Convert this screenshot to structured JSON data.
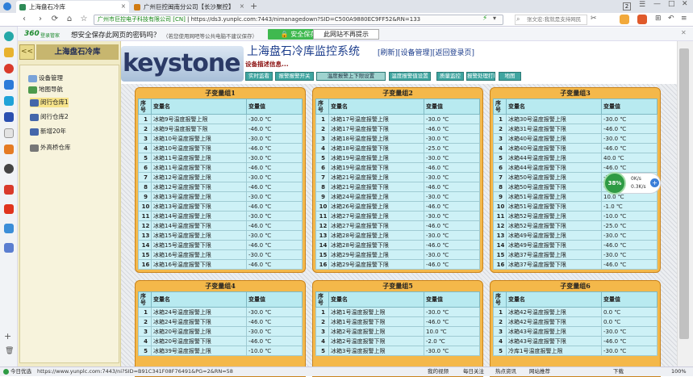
{
  "browser": {
    "tabs": [
      {
        "label": "上海盘石冷库",
        "color": "#2e8b57"
      },
      {
        "label": "广州巨控闽南分公司【长沙聚控】",
        "color": "#d07a10"
      }
    ],
    "tab_count": "2",
    "url_cert": "广州市巨控电子科技有限公司 [CN]",
    "url": "https://ds3.yunplc.com:7443/nimanagedown?SID=C500A9880EC9FF52&RN=133",
    "search_placeholder": "张文宏:我就是支持网民"
  },
  "password_bar": {
    "brand": "360",
    "brand_sub": "登录管家",
    "question": "想安全保存此网页的密码吗？",
    "hint": "（若您使用网吧等公共电脑不建议保存）",
    "save_label": "安全保存",
    "never_label": "此网站不再提示"
  },
  "left_panel": {
    "collapse_label": "<<",
    "system_name": "上海盘石冷库",
    "tree": [
      {
        "label": "设备管理",
        "icon": "gear-icon",
        "indent": 1,
        "color": "#7aa3d8",
        "selected": false
      },
      {
        "label": "地图导航",
        "icon": "globe-icon",
        "indent": 1,
        "color": "#4c9a4c",
        "selected": false
      },
      {
        "label": "闵行仓库1",
        "icon": "monitor-icon",
        "indent": 2,
        "color": "#4466aa",
        "selected": true
      },
      {
        "label": "闵行仓库2",
        "icon": "monitor-icon",
        "indent": 2,
        "color": "#4466aa",
        "selected": false
      },
      {
        "label": "新增20年",
        "icon": "monitor-icon",
        "indent": 2,
        "color": "#4466aa",
        "selected": false
      },
      {
        "label": "外高桥仓库",
        "icon": "monitor-icon",
        "indent": 2,
        "color": "#777777",
        "selected": false
      }
    ]
  },
  "header": {
    "logo_text": "keystone",
    "title": "上海盘石冷库监控系统",
    "links": "[刷新][设备管理][返回登录页]",
    "description": "设备描述信息...",
    "nav": [
      "实时监看",
      "报警报警开关",
      "温度报警上下限设置",
      "温度报警值设置",
      "质量监控",
      "报警处理打印",
      "地图"
    ],
    "nav_active": 2
  },
  "groups": [
    {
      "title": "子变量组1",
      "col_idx": "序号",
      "col_name": "变量名",
      "col_val": "变量值",
      "rows": [
        [
          "1",
          "冰箱9号温度报警上限",
          "-30.0 ℃"
        ],
        [
          "2",
          "冰箱9号温度报警下限",
          "-46.0 ℃"
        ],
        [
          "3",
          "冰箱10号温度报警上限",
          "-30.0 ℃"
        ],
        [
          "4",
          "冰箱10号温度报警下限",
          "-46.0 ℃"
        ],
        [
          "5",
          "冰箱11号温度报警上限",
          "-30.0 ℃"
        ],
        [
          "6",
          "冰箱11号温度报警下限",
          "-46.0 ℃"
        ],
        [
          "7",
          "冰箱12号温度报警上限",
          "-30.0 ℃"
        ],
        [
          "8",
          "冰箱12号温度报警下限",
          "-46.0 ℃"
        ],
        [
          "9",
          "冰箱13号温度报警上限",
          "-30.0 ℃"
        ],
        [
          "10",
          "冰箱13号温度报警下限",
          "-46.0 ℃"
        ],
        [
          "11",
          "冰箱14号温度报警上限",
          "-30.0 ℃"
        ],
        [
          "12",
          "冰箱14号温度报警下限",
          "-46.0 ℃"
        ],
        [
          "13",
          "冰箱15号温度报警上限",
          "-30.0 ℃"
        ],
        [
          "14",
          "冰箱15号温度报警下限",
          "-46.0 ℃"
        ],
        [
          "15",
          "冰箱16号温度报警上限",
          "-30.0 ℃"
        ],
        [
          "16",
          "冰箱16号温度报警下限",
          "-46.0 ℃"
        ]
      ]
    },
    {
      "title": "子变量组2",
      "col_idx": "序号",
      "col_name": "变量名",
      "col_val": "变量值",
      "rows": [
        [
          "1",
          "冰箱17号温度报警上限",
          "-30.0 ℃"
        ],
        [
          "2",
          "冰箱17号温度报警下限",
          "-46.0 ℃"
        ],
        [
          "3",
          "冰箱18号温度报警上限",
          "-30.0 ℃"
        ],
        [
          "4",
          "冰箱18号温度报警下限",
          "-25.0 ℃"
        ],
        [
          "5",
          "冰箱19号温度报警上限",
          "-30.0 ℃"
        ],
        [
          "6",
          "冰箱19号温度报警下限",
          "-46.0 ℃"
        ],
        [
          "7",
          "冰箱21号温度报警上限",
          "-30.0 ℃"
        ],
        [
          "8",
          "冰箱21号温度报警下限",
          "-46.0 ℃"
        ],
        [
          "9",
          "冰箱24号温度报警上限",
          "-30.0 ℃"
        ],
        [
          "10",
          "冰箱26号温度报警上限",
          "-46.0 ℃"
        ],
        [
          "11",
          "冰箱27号温度报警上限",
          "-30.0 ℃"
        ],
        [
          "12",
          "冰箱27号温度报警下限",
          "-46.0 ℃"
        ],
        [
          "13",
          "冰箱28号温度报警上限",
          "-30.0 ℃"
        ],
        [
          "14",
          "冰箱28号温度报警下限",
          "-46.0 ℃"
        ],
        [
          "15",
          "冰箱29号温度报警上限",
          "-30.0 ℃"
        ],
        [
          "16",
          "冰箱29号温度报警下限",
          "-46.0 ℃"
        ]
      ]
    },
    {
      "title": "子变量组3",
      "col_idx": "序号",
      "col_name": "变量名",
      "col_val": "变量值",
      "rows": [
        [
          "1",
          "冰箱30号温度报警上限",
          "-30.0 ℃"
        ],
        [
          "2",
          "冰箱31号温度报警下限",
          "-46.0 ℃"
        ],
        [
          "3",
          "冰箱40号温度报警上限",
          "-30.0 ℃"
        ],
        [
          "4",
          "冰箱40号温度报警下限",
          "-46.0 ℃"
        ],
        [
          "5",
          "冰箱44号温度报警上限",
          "40.0 ℃"
        ],
        [
          "6",
          "冰箱44号温度报警下限",
          "-46.0 ℃"
        ],
        [
          "7",
          "冰箱50号温度报警上限",
          "-30.0 ℃"
        ],
        [
          "8",
          "冰箱50号温度报警下限",
          "-46.0 ℃"
        ],
        [
          "9",
          "冰箱51号温度报警上限",
          "10.0 ℃"
        ],
        [
          "10",
          "冰箱51号温度报警下限",
          "-1.0 ℃"
        ],
        [
          "11",
          "冰箱52号温度报警上限",
          "-10.0 ℃"
        ],
        [
          "12",
          "冰箱52号温度报警下限",
          "-25.0 ℃"
        ],
        [
          "13",
          "冰箱49号温度报警上限",
          "-30.0 ℃"
        ],
        [
          "14",
          "冰箱49号温度报警下限",
          "-46.0 ℃"
        ],
        [
          "15",
          "冰箱37号温度报警上限",
          "-30.0 ℃"
        ],
        [
          "16",
          "冰箱37号温度报警下限",
          "-46.0 ℃"
        ]
      ]
    },
    {
      "title": "子变量组4",
      "col_idx": "序号",
      "col_name": "变量名",
      "col_val": "变量值",
      "rows": [
        [
          "1",
          "冰箱24号温度报警上限",
          "-30.0 ℃"
        ],
        [
          "2",
          "冰箱24号温度报警下限",
          "-46.0 ℃"
        ],
        [
          "3",
          "冰箱20号温度报警上限",
          "-30.0 ℃"
        ],
        [
          "4",
          "冰箱20号温度报警下限",
          "-46.0 ℃"
        ],
        [
          "5",
          "冰箱39号温度报警上限",
          "-10.0 ℃"
        ]
      ]
    },
    {
      "title": "子变量组5",
      "col_idx": "序号",
      "col_name": "变量名",
      "col_val": "变量值",
      "rows": [
        [
          "1",
          "冰箱1号温度报警上限",
          "-30.0 ℃"
        ],
        [
          "2",
          "冰箱1号温度报警下限",
          "-46.0 ℃"
        ],
        [
          "3",
          "冰箱2号温度报警上限",
          "10.0 ℃"
        ],
        [
          "4",
          "冰箱2号温度报警下限",
          "-2.0 ℃"
        ],
        [
          "5",
          "冰箱3号温度报警上限",
          "-30.0 ℃"
        ]
      ]
    },
    {
      "title": "子变量组6",
      "col_idx": "序号",
      "col_name": "变量名",
      "col_val": "变量值",
      "rows": [
        [
          "1",
          "冰箱42号温度报警上限",
          "0.0 ℃"
        ],
        [
          "2",
          "冰箱42号温度报警下限",
          "0.0 ℃"
        ],
        [
          "3",
          "冰箱43号温度报警上限",
          "-30.0 ℃"
        ],
        [
          "4",
          "冰箱43号温度报警下限",
          "-46.0 ℃"
        ],
        [
          "5",
          "冷库1号温度报警上限",
          "-30.0 ℃"
        ]
      ]
    }
  ],
  "widget": {
    "percent": "38%",
    "up": "0K/s",
    "down": "0.3K/s"
  },
  "status": {
    "left": "今日优选",
    "url": "https://www.yunplc.com:7443/ni?SID=B91C341F08F76491&PG=2&RN=58",
    "items": [
      "我的视频",
      "每日关注",
      "热点资讯",
      "网站推荐",
      "下载"
    ],
    "zoom": "100%"
  }
}
